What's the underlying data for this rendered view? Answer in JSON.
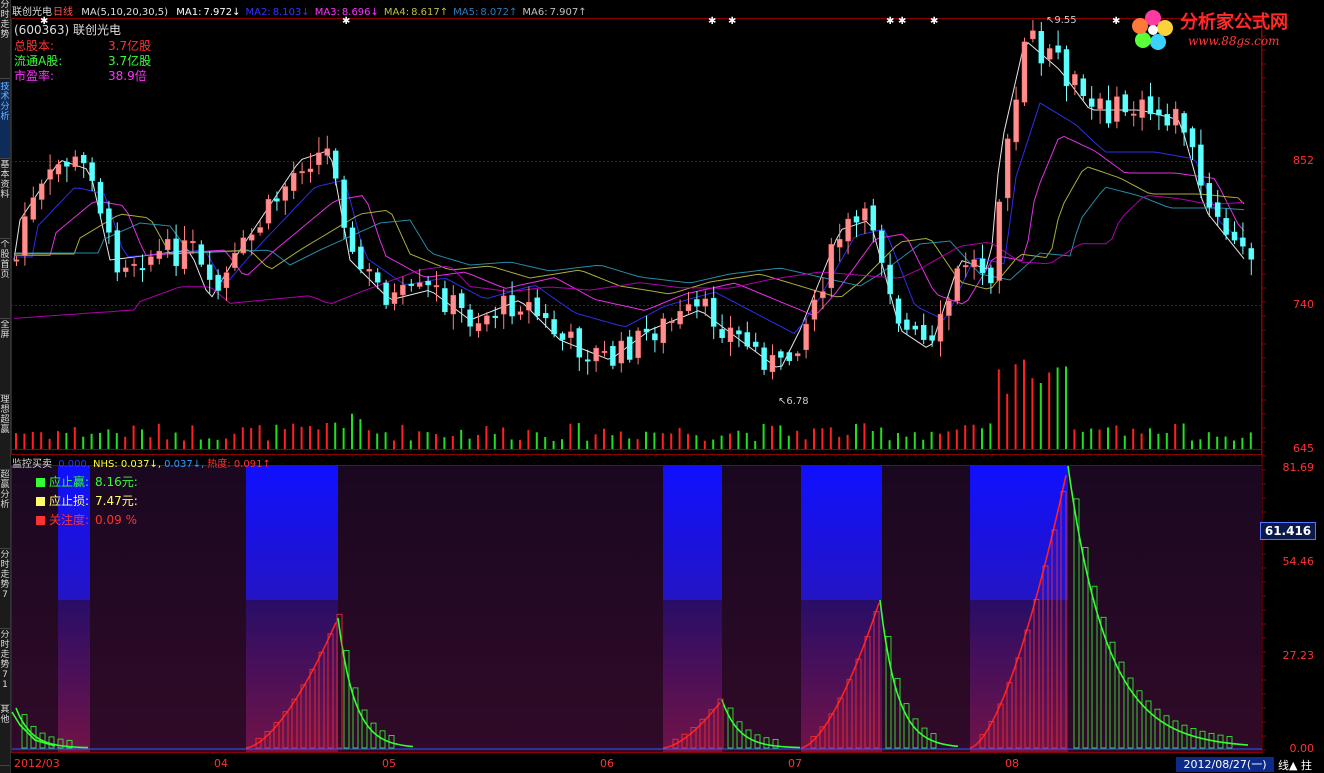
{
  "sidebar": {
    "tabs": [
      {
        "label": "分时走势",
        "active": false
      },
      {
        "label": "技术分析",
        "active": true
      },
      {
        "label": "基本资料",
        "active": false
      },
      {
        "label": "个股首页",
        "active": false
      },
      {
        "label": "全屏",
        "active": false
      },
      {
        "label": "理想超赢",
        "active": false
      },
      {
        "label": "超赢分析",
        "active": false
      },
      {
        "label": "分时走势7",
        "active": false
      },
      {
        "label": "分时走势71",
        "active": false
      },
      {
        "label": "其他",
        "active": false
      }
    ]
  },
  "header": {
    "stock_name": "联创光电",
    "period": "日线",
    "ma_params": "MA(5,10,20,30,5)",
    "ma": [
      {
        "label": "MA1:",
        "value": "7.972↓",
        "color": "#ffffff"
      },
      {
        "label": "MA2:",
        "value": "8.103↓",
        "color": "#3333ff"
      },
      {
        "label": "MA3:",
        "value": "8.696↓",
        "color": "#ff33ff"
      },
      {
        "label": "MA4:",
        "value": "8.617↑",
        "color": "#bfbf3f"
      },
      {
        "label": "MA5:",
        "value": "8.072↑",
        "color": "#2a7ab8"
      },
      {
        "label": "MA6:",
        "value": "7.907↑",
        "color": "#c0c0c0"
      }
    ]
  },
  "stock_info": {
    "code_line": "(600363) 联创光电",
    "rows": [
      {
        "label": "总股本:",
        "value": "3.7亿股",
        "color": "#ff3232"
      },
      {
        "label": "流通A股:",
        "value": "3.7亿股",
        "color": "#33ff33"
      },
      {
        "label": "市盈率:",
        "value": "38.9倍",
        "color": "#ff33ff"
      }
    ]
  },
  "logo": {
    "name": "分析家公式网",
    "url": "www.88gs.com"
  },
  "price_axis": {
    "labels": [
      "852",
      "740",
      "645"
    ]
  },
  "annotations": {
    "high": "9.55",
    "low": "6.78"
  },
  "indicator": {
    "name": "监控买卖",
    "values": [
      {
        "text": "0.000,",
        "color": "#3333ff"
      },
      {
        "text": "NHS: 0.037↓,",
        "color": "#ffff33"
      },
      {
        "text": "0.037↓,",
        "color": "#3399ff"
      },
      {
        "text": "热度: 0.091↑",
        "color": "#ff3232"
      }
    ],
    "legend": [
      {
        "label": "应止赢:",
        "value": "8.16元:",
        "color": "#33ff33",
        "label_color": "#33ff33"
      },
      {
        "label": "应止损:",
        "value": "7.47元:",
        "color": "#ffff66",
        "label_color": "#ffff66"
      },
      {
        "label": "关注度:",
        "value": "0.09 %",
        "color": "#ff3232",
        "label_color": "#ff3232"
      }
    ],
    "axis_labels": [
      "81.69",
      "54.46",
      "27.23",
      "0.00"
    ],
    "current_value": "61.416"
  },
  "date_axis": {
    "labels": [
      "2012/03",
      "04",
      "05",
      "06",
      "07",
      "08"
    ],
    "current_date": "2012/08/27(一)",
    "bottom_right": "线▲ 拄"
  }
}
